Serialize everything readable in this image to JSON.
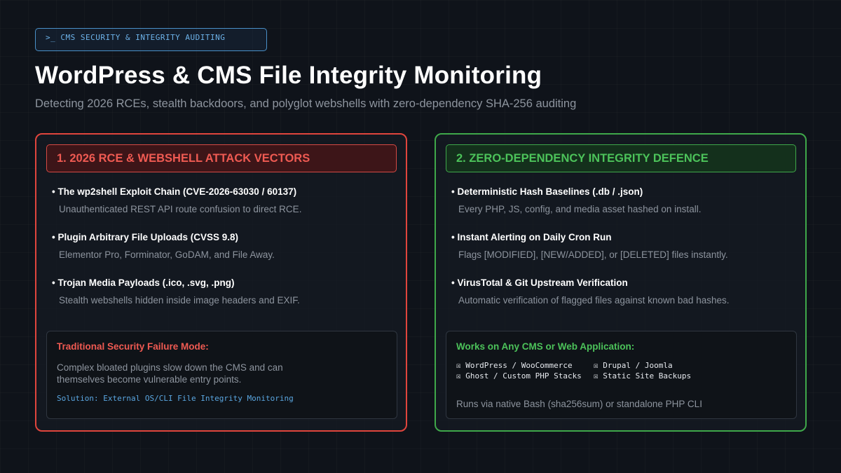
{
  "header": {
    "tag": ">_ CMS SECURITY & INTEGRITY AUDITING",
    "title": "WordPress & CMS File Integrity Monitoring",
    "subtitle": "Detecting 2026 RCEs, stealth backdoors, and polyglot webshells with zero-dependency SHA-256 auditing"
  },
  "colors": {
    "attack": "#e0453d",
    "defence": "#3fa84a",
    "accent": "#5aa6e0"
  },
  "left_panel": {
    "heading": "1. 2026 RCE & WEBSHELL ATTACK VECTORS",
    "items": [
      {
        "title": "• The wp2shell Exploit Chain (CVE-2026-63030 / 60137)",
        "desc": "Unauthenticated REST API route confusion to direct RCE."
      },
      {
        "title": "• Plugin Arbitrary File Uploads (CVSS 9.8)",
        "desc": "Elementor Pro, Forminator, GoDAM, and File Away."
      },
      {
        "title": "• Trojan Media Payloads (.ico, .svg, .png)",
        "desc": "Stealth webshells hidden inside image headers and EXIF."
      }
    ],
    "box": {
      "title": "Traditional Security Failure Mode:",
      "text": "Complex bloated plugins slow down the CMS and can themselves become vulnerable entry points.",
      "solution": "Solution: External OS/CLI File Integrity Monitoring"
    }
  },
  "right_panel": {
    "heading": "2. ZERO-DEPENDENCY INTEGRITY DEFENCE",
    "items": [
      {
        "title": "• Deterministic Hash Baselines (.db / .json)",
        "desc": "Every PHP, JS, config, and media asset hashed on install."
      },
      {
        "title": "• Instant Alerting on Daily Cron Run",
        "desc": "Flags [MODIFIED], [NEW/ADDED], or [DELETED] files instantly."
      },
      {
        "title": "• VirusTotal & Git Upstream Verification",
        "desc": "Automatic verification of flagged files against known bad hashes."
      }
    ],
    "box": {
      "title": "Works on Any CMS or Web Application:",
      "cms": [
        "☒ WordPress / WooCommerce",
        "☒ Drupal / Joomla",
        "☒ Ghost / Custom PHP Stacks",
        "☒ Static Site Backups"
      ],
      "footer": "Runs via native Bash (sha256sum) or standalone PHP CLI"
    }
  }
}
